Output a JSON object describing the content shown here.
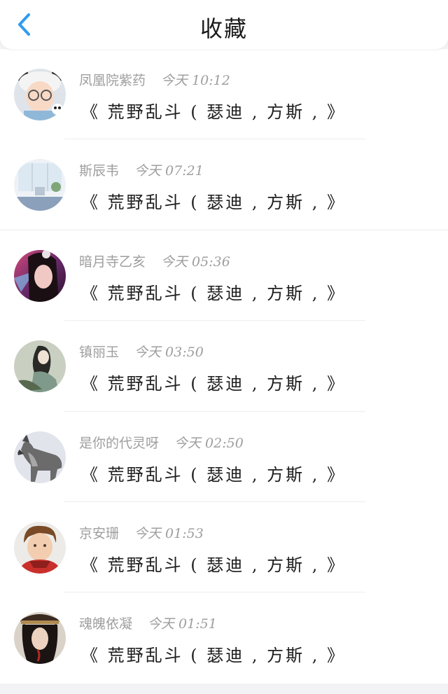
{
  "header": {
    "title": "收藏",
    "back_icon": "chevron-left-icon",
    "accent_color": "#2f9bf0"
  },
  "favorites": [
    {
      "sender": "凤凰院紫药",
      "time": "今天 10:12",
      "text": "《 荒野乱斗 ( 瑟迪 , 方斯 , 》",
      "avatar": "girl-with-bear-hat-avatar"
    },
    {
      "sender": "斯辰韦",
      "time": "今天 07:21",
      "text": "《 荒野乱斗 ( 瑟迪 , 方斯 , 》",
      "avatar": "window-room-avatar"
    },
    {
      "sender": "暗月寺乙亥",
      "time": "今天 05:36",
      "text": "《 荒野乱斗 ( 瑟迪 , 方斯 , 》",
      "avatar": "dark-hair-girl-avatar"
    },
    {
      "sender": "镇丽玉",
      "time": "今天 03:50",
      "text": "《 荒野乱斗 ( 瑟迪 , 方斯 , 》",
      "avatar": "painted-lady-avatar"
    },
    {
      "sender": "是你的代灵呀",
      "time": "今天 02:50",
      "text": "《 荒野乱斗 ( 瑟迪 , 方斯 , 》",
      "avatar": "wolf-avatar"
    },
    {
      "sender": "京安珊",
      "time": "今天 01:53",
      "text": "《 荒野乱斗 ( 瑟迪 , 方斯 , 》",
      "avatar": "boy-red-scarf-avatar"
    },
    {
      "sender": "魂魄依凝",
      "time": "今天 01:51",
      "text": "《 荒野乱斗 ( 瑟迪 , 方斯 , 》",
      "avatar": "ancient-warrior-avatar"
    }
  ]
}
